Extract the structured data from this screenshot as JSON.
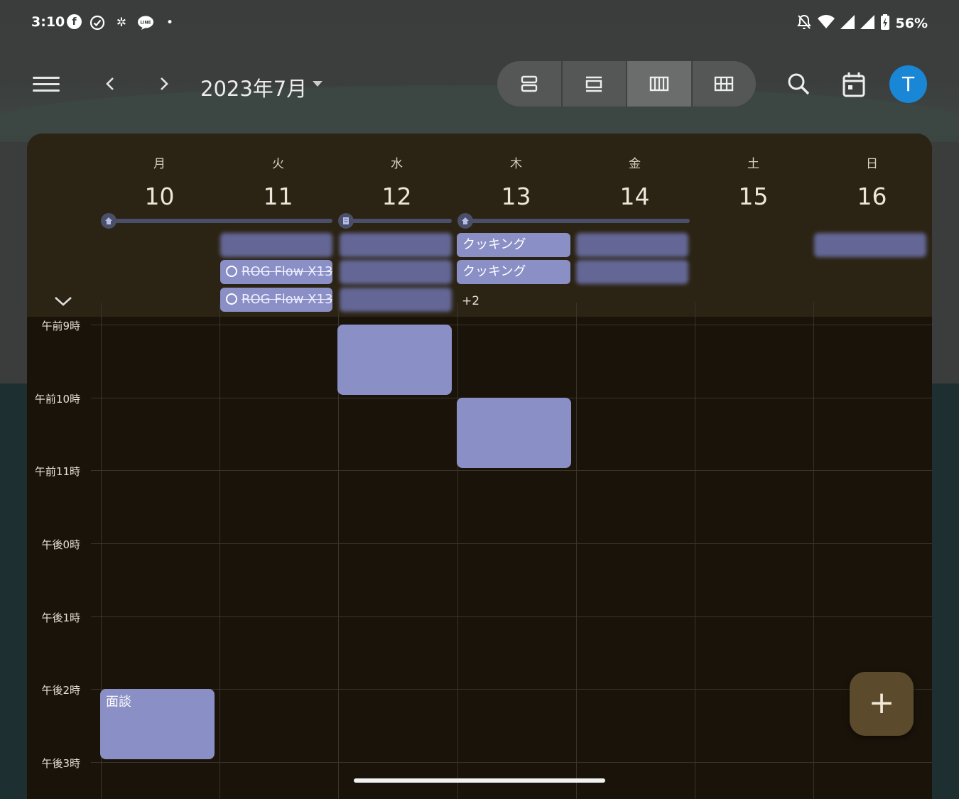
{
  "status_bar": {
    "time": "3:10",
    "battery": "56%",
    "left_icons": [
      "facebook-icon",
      "check-circle-icon",
      "pinwheel-icon",
      "line-icon",
      "dot-icon"
    ],
    "right_icons": [
      "bell-off-icon",
      "wifi-icon",
      "signal-icon",
      "signal-icon",
      "battery-charging-icon"
    ],
    "line_badge": "LINE"
  },
  "header": {
    "title": "2023年7月",
    "avatar_initial": "T",
    "views": [
      "schedule-view-icon",
      "day-view-icon",
      "week-view-icon",
      "month-view-icon"
    ],
    "active_view": 2
  },
  "week": {
    "days": [
      {
        "dow": "月",
        "num": "10"
      },
      {
        "dow": "火",
        "num": "11"
      },
      {
        "dow": "水",
        "num": "12"
      },
      {
        "dow": "木",
        "num": "13"
      },
      {
        "dow": "金",
        "num": "14"
      },
      {
        "dow": "土",
        "num": "15"
      },
      {
        "dow": "日",
        "num": "16"
      }
    ]
  },
  "all_day": {
    "cooking_1": "クッキング",
    "cooking_2": "クッキング",
    "rog_1": "ROG Flow X13",
    "rog_2": "ROG Flow X13 |",
    "more": "+2"
  },
  "times": [
    "午前9時",
    "午前10時",
    "午前11時",
    "午後0時",
    "午後1時",
    "午後2時",
    "午後3時"
  ],
  "events": {
    "interview": "面談"
  },
  "colors": {
    "event": "#8a8fc6",
    "panel": "#1a130a",
    "avatar": "#1a86d6",
    "fab": "#5b4a2c"
  },
  "fab_label": "+"
}
